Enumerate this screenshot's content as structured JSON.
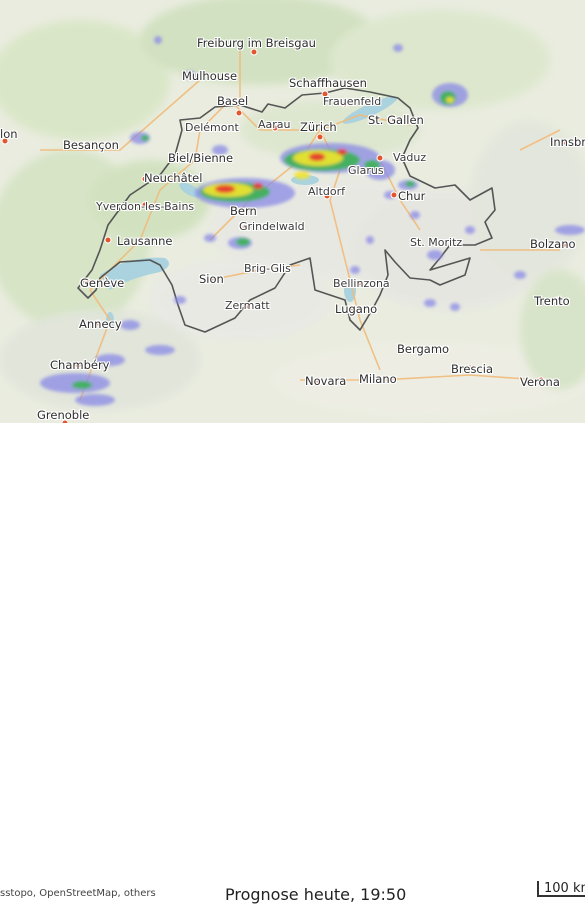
{
  "map": {
    "places": [
      {
        "id": "freiburg",
        "name": "Freiburg im Breisgau"
      },
      {
        "id": "mulhouse",
        "name": "Mulhouse"
      },
      {
        "id": "schaffhausen",
        "name": "Schaffhausen"
      },
      {
        "id": "frauenfeld",
        "name": "Frauenfeld"
      },
      {
        "id": "basel",
        "name": "Basel"
      },
      {
        "id": "stgallen",
        "name": "St. Gallen"
      },
      {
        "id": "delemont",
        "name": "Delémont"
      },
      {
        "id": "aarau",
        "name": "Aarau"
      },
      {
        "id": "zurich",
        "name": "Zürich"
      },
      {
        "id": "besancon",
        "name": "Besançon"
      },
      {
        "id": "biel",
        "name": "Biel/Bienne"
      },
      {
        "id": "innsbruck",
        "name": "Innsbr"
      },
      {
        "id": "vaduz",
        "name": "Vaduz"
      },
      {
        "id": "neuchatel",
        "name": "Neuchâtel"
      },
      {
        "id": "glarus",
        "name": "Glarus"
      },
      {
        "id": "altdorf",
        "name": "Altdorf"
      },
      {
        "id": "chur",
        "name": "Chur"
      },
      {
        "id": "yverdon",
        "name": "Yverdon-les-Bains"
      },
      {
        "id": "bern",
        "name": "Bern"
      },
      {
        "id": "grindelwald",
        "name": "Grindelwald"
      },
      {
        "id": "lausanne",
        "name": "Lausanne"
      },
      {
        "id": "stmoritz",
        "name": "St. Moritz"
      },
      {
        "id": "bolzano",
        "name": "Bolzano"
      },
      {
        "id": "geneve",
        "name": "Genève"
      },
      {
        "id": "sion",
        "name": "Sion"
      },
      {
        "id": "brig",
        "name": "Brig-Glis"
      },
      {
        "id": "bellinzona",
        "name": "Bellinzona"
      },
      {
        "id": "trento",
        "name": "Trento"
      },
      {
        "id": "annecy",
        "name": "Annecy"
      },
      {
        "id": "zermatt",
        "name": "Zermatt"
      },
      {
        "id": "lugano",
        "name": "Lugano"
      },
      {
        "id": "bergamo",
        "name": "Bergamo"
      },
      {
        "id": "chambery",
        "name": "Chambéry"
      },
      {
        "id": "brescia",
        "name": "Brescia"
      },
      {
        "id": "novara",
        "name": "Novara"
      },
      {
        "id": "milano",
        "name": "Milano"
      },
      {
        "id": "verona",
        "name": "Verona"
      },
      {
        "id": "grenoble",
        "name": "Grenoble"
      },
      {
        "id": "lon",
        "name": "lon"
      }
    ],
    "colors": {
      "border": "#555555",
      "rain_light": "#8a8ae6",
      "rain_moderate": "#36b34a",
      "rain_heavy": "#f2e530",
      "rain_very_heavy": "#e63a2e",
      "city_dot": "#e2552e"
    }
  },
  "footer": {
    "attribution": "sstopo, OpenStreetMap, others",
    "timestamp": "Prognose heute, 19:50",
    "scale_label": "100 km"
  }
}
